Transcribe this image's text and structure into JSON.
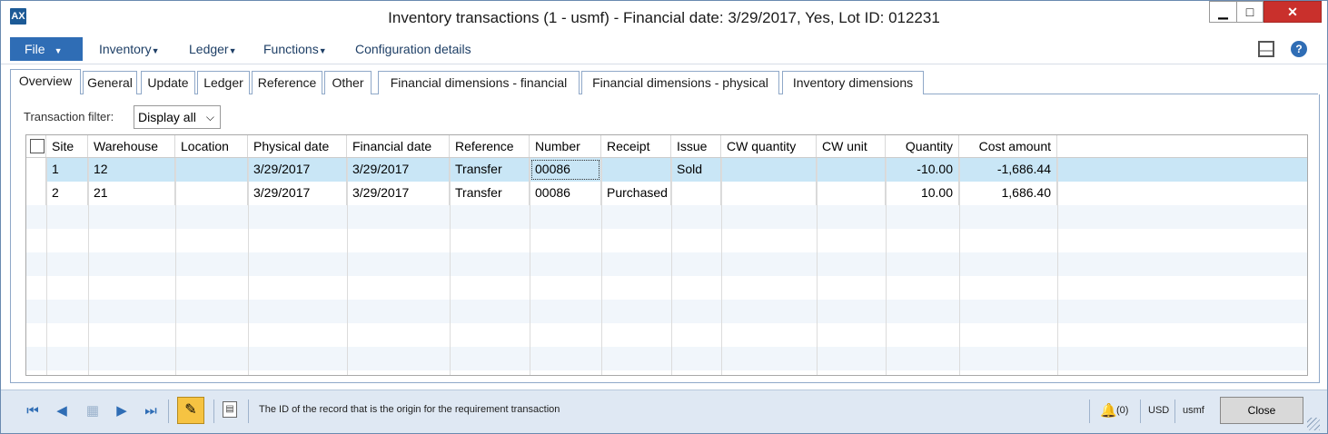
{
  "window": {
    "title": "Inventory transactions (1 - usmf) - Financial date: 3/29/2017, Yes, Lot ID: 012231",
    "app_icon": "ax-app-icon",
    "controls": {
      "minimize": "minimize-icon",
      "maximize": "maximize-icon",
      "close": "close-icon"
    }
  },
  "menu": {
    "file_label": "File",
    "items": [
      {
        "label": "Inventory",
        "has_dropdown": true
      },
      {
        "label": "Ledger",
        "has_dropdown": true
      },
      {
        "label": "Functions",
        "has_dropdown": true
      },
      {
        "label": "Configuration details",
        "has_dropdown": false
      }
    ],
    "right_icons": [
      "panel-icon",
      "help-icon"
    ]
  },
  "tabs": [
    {
      "label": "Overview",
      "active": true
    },
    {
      "label": "General"
    },
    {
      "label": "Update"
    },
    {
      "label": "Ledger"
    },
    {
      "label": "Reference"
    },
    {
      "label": "Other"
    },
    {
      "label": "Financial dimensions - financial"
    },
    {
      "label": "Financial dimensions - physical"
    },
    {
      "label": "Inventory dimensions"
    }
  ],
  "filter": {
    "label": "Transaction filter:",
    "value": "Display all"
  },
  "grid": {
    "columns": [
      "Site",
      "Warehouse",
      "Location",
      "Physical date",
      "Financial date",
      "Reference",
      "Number",
      "Receipt",
      "Issue",
      "CW quantity",
      "CW unit",
      "Quantity",
      "Cost amount"
    ],
    "rows": [
      [
        "1",
        "12",
        "",
        "3/29/2017",
        "3/29/2017",
        "Transfer",
        "00086",
        "",
        "Sold",
        "",
        "",
        "-10.00",
        "-1,686.44"
      ],
      [
        "2",
        "21",
        "",
        "3/29/2017",
        "3/29/2017",
        "Transfer",
        "00086",
        "Purchased",
        "",
        "",
        "",
        "10.00",
        "1,686.40"
      ]
    ],
    "selected_row": 0
  },
  "status": {
    "text": "The ID of the record that is the origin for the requirement transaction",
    "notifications": "(0)",
    "currency": "USD",
    "company": "usmf",
    "close_label": "Close"
  }
}
